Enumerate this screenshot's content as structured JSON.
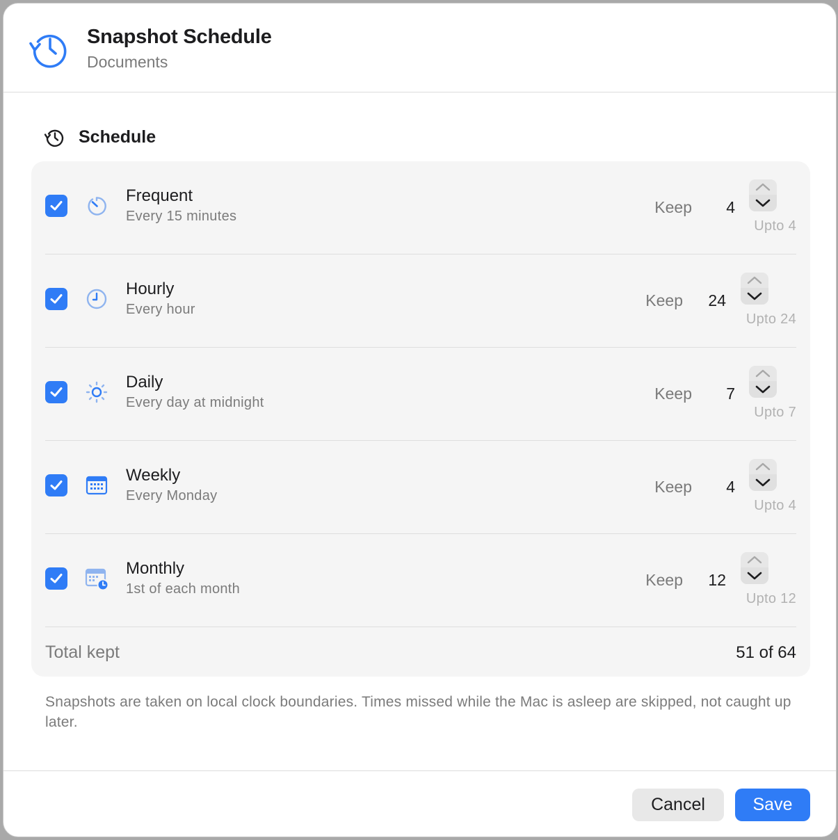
{
  "header": {
    "title": "Snapshot Schedule",
    "subtitle": "Documents",
    "icon": "clock-history-icon"
  },
  "section": {
    "title": "Schedule",
    "icon": "history-icon"
  },
  "rows": [
    {
      "name": "Frequent",
      "description": "Every 15 minutes",
      "checked": true,
      "icon": "timer-icon",
      "keep_label": "Keep",
      "keep": "4",
      "upto": "Upto 4"
    },
    {
      "name": "Hourly",
      "description": "Every hour",
      "checked": true,
      "icon": "clock-icon",
      "keep_label": "Keep",
      "keep": "24",
      "upto": "Upto 24"
    },
    {
      "name": "Daily",
      "description": "Every day at midnight",
      "checked": true,
      "icon": "sun-icon",
      "keep_label": "Keep",
      "keep": "7",
      "upto": "Upto 7"
    },
    {
      "name": "Weekly",
      "description": "Every Monday",
      "checked": true,
      "icon": "calendar-icon",
      "keep_label": "Keep",
      "keep": "4",
      "upto": "Upto 4"
    },
    {
      "name": "Monthly",
      "description": "1st of each month",
      "checked": true,
      "icon": "calendar-clock-icon",
      "keep_label": "Keep",
      "keep": "12",
      "upto": "Upto 12"
    }
  ],
  "total": {
    "label": "Total kept",
    "value": "51 of 64"
  },
  "note": "Snapshots are taken on local clock boundaries. Times missed while the Mac is asleep are skipped, not caught up later.",
  "buttons": {
    "cancel": "Cancel",
    "save": "Save"
  },
  "colors": {
    "accent": "#2f7cf6",
    "icon_light": "#8fb4ef"
  }
}
